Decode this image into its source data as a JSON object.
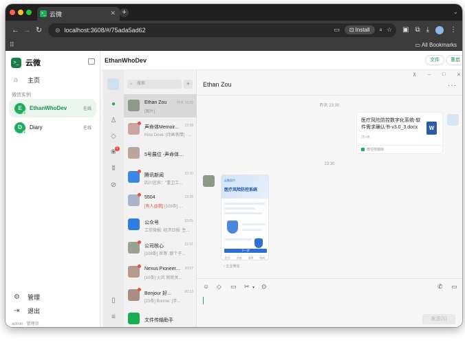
{
  "browser": {
    "tab_title": "云微",
    "tab_favicon": ">_",
    "url": "localhost:3608/#/75ada5ad62",
    "install_label": "Install",
    "all_bookmarks": "All Bookmarks"
  },
  "app": {
    "name": "云微",
    "logo_glyph": ">_",
    "nav": {
      "home": "主页",
      "manage": "管理",
      "logout": "退出"
    },
    "section_label": "微信实例",
    "accounts": [
      {
        "initial": "E",
        "name": "EthanWhoDev",
        "status": "在线",
        "active": true
      },
      {
        "initial": "D",
        "name": "Diary",
        "status": "在线",
        "active": false
      }
    ],
    "footer": "admin · 管理员",
    "header": {
      "title": "EthanWhoDev",
      "files_btn": "文件",
      "restart_btn": "重启"
    }
  },
  "wechat": {
    "search_placeholder": "搜索",
    "badge_count": "1",
    "chats": [
      {
        "name": "Ethan Zou",
        "time": "昨天 23:30",
        "msg": "[图片]",
        "selected": true,
        "dot": false,
        "avatar_color": "#8d9a88"
      },
      {
        "name": "声命体Memoir...",
        "time": "23:38",
        "msg": "Kino Dove: [动画表情] · ...",
        "selected": false,
        "dot": true,
        "avatar_color": "#c9a7a0"
      },
      {
        "name": "5号展位 -声命体Me...",
        "time": "",
        "msg": "",
        "selected": false,
        "dot": false,
        "avatar_color": "#b8a79a"
      },
      {
        "name": "腾讯新闻",
        "time": "23:30",
        "msg": "四川宜宾：\"重卫工...",
        "selected": false,
        "dot": true,
        "avatar_color": "#3d86e5"
      },
      {
        "name": "5504",
        "time": "23:35",
        "msg_red": "[有人@我]",
        "msg": " [108条] ...",
        "selected": false,
        "dot": true,
        "avatar_color": "#a8b4c8"
      },
      {
        "name": "公众号",
        "time": "23:05",
        "msg": "工信微报: 经济日报: 生...",
        "selected": false,
        "dot": false,
        "avatar_color": "#2f7ee0"
      },
      {
        "name": "公司核心",
        "time": "21:51",
        "msg": "[108条] 良哥: 那个于...",
        "selected": false,
        "dot": true,
        "avatar_color": "#9aa38f"
      },
      {
        "name": "Nexus Pioneer...",
        "time": "20:57",
        "msg": "[10条] 火凤 刚刚关...",
        "selected": false,
        "dot": true,
        "avatar_color": "#b59c8a"
      },
      {
        "name": " Bonjour 好...",
        "time": "20:13",
        "msg": "[23条] Bonnie: [手...",
        "selected": false,
        "dot": true,
        "avatar_color": "#a88f86"
      },
      {
        "name": "文件传输助手",
        "time": "",
        "msg": "",
        "selected": false,
        "dot": false,
        "avatar_color": "#1aad55"
      }
    ],
    "conversation": {
      "title": "Ethan Zou",
      "time1": "昨天 23:30",
      "file": {
        "name": "医疗风险防控数字化系统-软件需求确认书-v3.0_3.docx",
        "size": "25.0K",
        "source": "微信电脑版",
        "icon_letter": "W"
      },
      "time2": "23:30",
      "image": {
        "brand": "云数医疗",
        "title": "医疗风险防控系统",
        "button": "下一步",
        "nav": [
          "首页",
          "文档",
          "消息",
          "我的"
        ]
      },
      "image_source": "企业微信",
      "send_label": "发送(S)"
    }
  }
}
